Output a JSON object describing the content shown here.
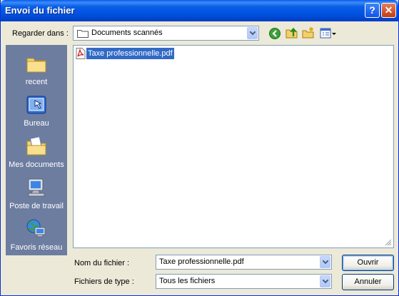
{
  "window": {
    "title": "Envoi du fichier",
    "help_glyph": "?",
    "close_glyph": "✕"
  },
  "lookin": {
    "label": "Regarder dans :",
    "value": "Documents scannés"
  },
  "toolbar": {
    "icons": [
      "back-icon",
      "up-folder-icon",
      "new-folder-icon",
      "view-menu-icon"
    ]
  },
  "places": [
    {
      "label": "recent",
      "icon": "recent-folder-icon"
    },
    {
      "label": "Bureau",
      "icon": "desktop-icon"
    },
    {
      "label": "Mes documents",
      "icon": "my-documents-icon"
    },
    {
      "label": "Poste de travail",
      "icon": "my-computer-icon"
    },
    {
      "label": "Favoris réseau",
      "icon": "network-places-icon"
    }
  ],
  "files": [
    {
      "name": "Taxe professionnelle.pdf",
      "icon": "pdf-file-icon",
      "selected": true
    }
  ],
  "filename": {
    "label": "Nom du fichier :",
    "value": "Taxe professionnelle.pdf"
  },
  "filetype": {
    "label": "Fichiers de type :",
    "value": "Tous les fichiers"
  },
  "buttons": {
    "open": "Ouvrir",
    "cancel": "Annuler"
  },
  "colors": {
    "titlebar": "#0054e3",
    "selection": "#316ac5",
    "places_bg": "#6d7da0",
    "dialog_bg": "#ece9d8"
  }
}
